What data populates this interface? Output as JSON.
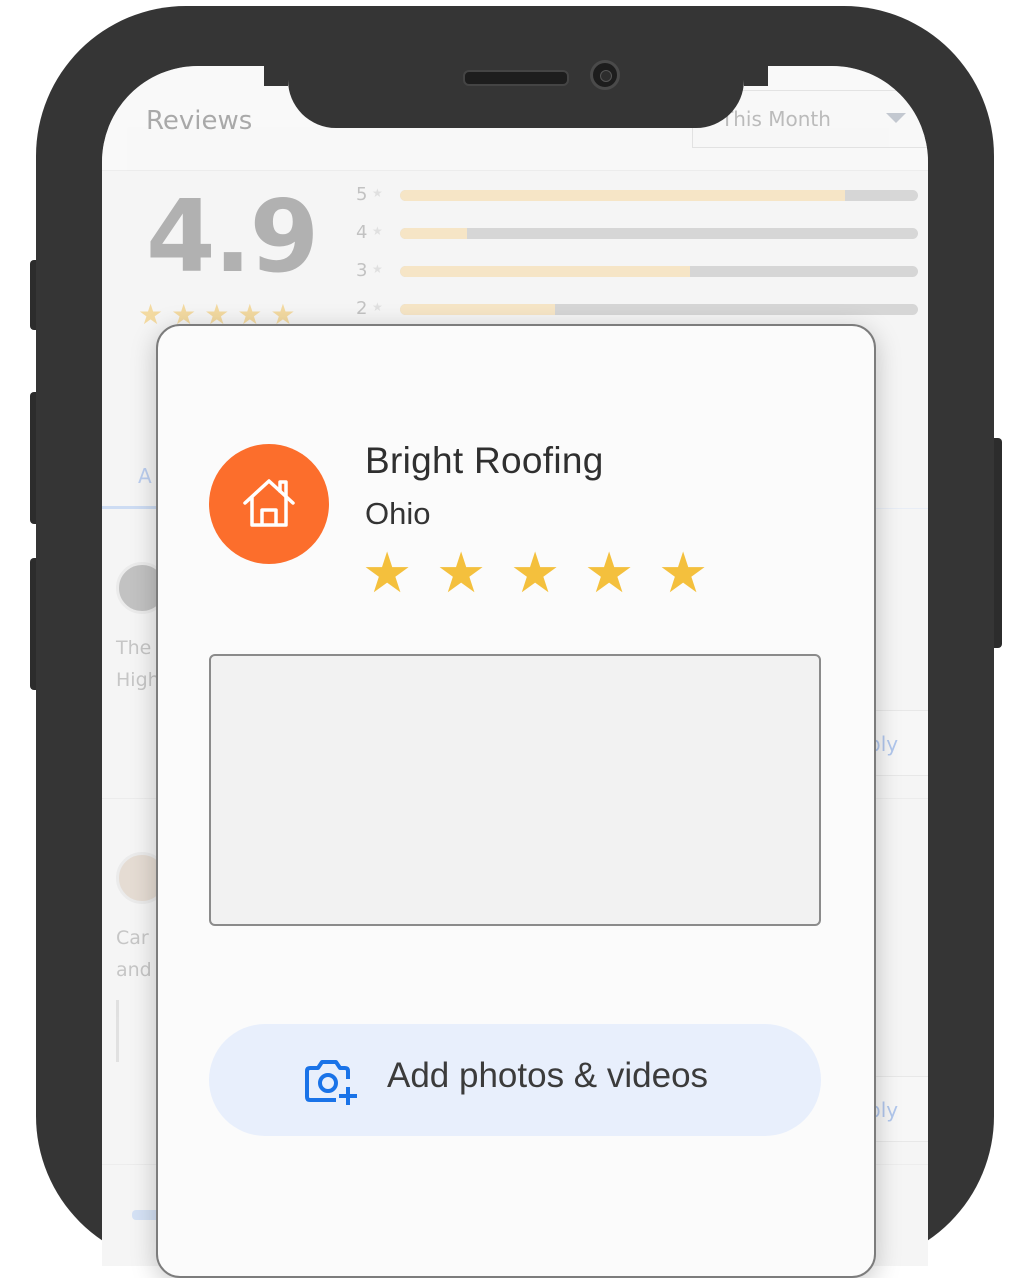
{
  "background_app": {
    "title": "Reviews",
    "filter": {
      "selected": "This Month"
    },
    "rating": {
      "average": "4.9",
      "stars": "★★★★★"
    },
    "distribution": [
      {
        "label": "5",
        "fill": 0.86
      },
      {
        "label": "4",
        "fill": 0.13
      },
      {
        "label": "3",
        "fill": 0.56
      },
      {
        "label": "2",
        "fill": 0.3
      }
    ],
    "tab_active": "A",
    "reviews": [
      {
        "snippet_line1": "The",
        "snippet_line2": "High",
        "reply": "ply"
      },
      {
        "snippet_line1": "Car",
        "snippet_line2": "and",
        "reply": "ply"
      }
    ]
  },
  "review_card": {
    "business_name": "Bright Roofing",
    "location": "Ohio",
    "rating_stars": [
      "★",
      "★",
      "★",
      "★",
      "★"
    ],
    "review_placeholder": "",
    "add_media_label": "Add photos & videos"
  },
  "colors": {
    "logo": "#fc6e2c",
    "star": "#f4c03d",
    "add_media_bg": "#e8effc",
    "add_media_icon": "#1a73e8",
    "phone": "#353535"
  },
  "icons": {
    "logo": "house-icon",
    "add_media": "add-photo-camera-icon"
  }
}
